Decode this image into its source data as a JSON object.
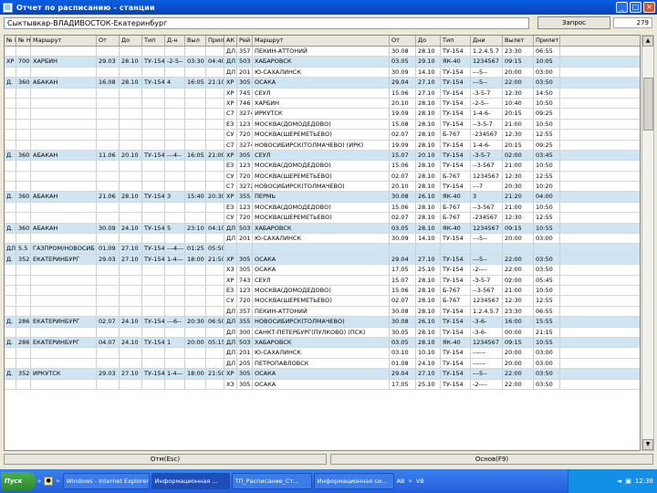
{
  "window": {
    "title": "Отчет по расписанию - станции",
    "buttons": [
      "_",
      "□",
      "×"
    ]
  },
  "filter": {
    "text": "Сыктывкар-ВЛАДИВОСТОК-Екатеринбург",
    "query_button": "Запрос",
    "count": "279"
  },
  "columns": [
    "№ Но",
    "№ Но",
    "Маршрут",
    "От",
    "До",
    "Тип",
    "Д-н",
    "Выл",
    "Прил",
    "АК",
    "Рей",
    "Маршрут",
    "От",
    "До",
    "Тип",
    "Дни",
    "Вылет",
    "Прилет"
  ],
  "rows": [
    {
      "band": false,
      "c": [
        "",
        "",
        "",
        "",
        "",
        "",
        "",
        "",
        "",
        "ДЛ",
        "357",
        "ПЕКИН-АТТОНИЙ",
        "30.08",
        "28.10",
        "ТУ-154",
        "1.2.4.5.7",
        "23:30",
        "06:55"
      ]
    },
    {
      "band": true,
      "c": [
        "ХР",
        "700",
        "ХАРБИН",
        "29.03",
        "28.10",
        "ТУ-154",
        "-2-5--",
        "03:30",
        "04:40",
        "ДЛ",
        "503",
        "ХАБАРОВСК",
        "03.05",
        "29.10",
        "ЯК-40",
        "1234567",
        "09:15",
        "10:05"
      ]
    },
    {
      "band": false,
      "c": [
        "",
        "",
        "",
        "",
        "",
        "",
        "",
        "",
        "",
        "ДЛ",
        "201",
        "Ю-САХАЛИНСК",
        "30.09",
        "14.10",
        "ТУ-154",
        "---5--",
        "20:00",
        "03:00"
      ]
    },
    {
      "band": true,
      "c": [
        "Д.",
        "360",
        "АБАКАН",
        "16.08",
        "28.10",
        "ТУ-154",
        "4",
        "16:05",
        "21:10",
        "ХР",
        "305",
        "ОСАКА",
        "29.04",
        "27.10",
        "ТУ-154",
        "---5--",
        "22:00",
        "03:50"
      ]
    },
    {
      "band": false,
      "c": [
        "",
        "",
        "",
        "",
        "",
        "",
        "",
        "",
        "",
        "ХР",
        "745",
        "СЕУЛ",
        "15.06",
        "27.10",
        "ТУ-154",
        "-3-5-7",
        "12:30",
        "14:50"
      ]
    },
    {
      "band": false,
      "c": [
        "",
        "",
        "",
        "",
        "",
        "",
        "",
        "",
        "",
        "ХР",
        "746",
        "ХАРБИН",
        "20.10",
        "28.10",
        "ТУ-154",
        "-2-5--",
        "10:40",
        "10:50"
      ]
    },
    {
      "band": false,
      "c": [
        "",
        "",
        "",
        "",
        "",
        "",
        "",
        "",
        "",
        "С7",
        "3274",
        "ИРКУТСК",
        "19.09",
        "28.10",
        "ТУ-154",
        "1-4-6-",
        "20:15",
        "09:25"
      ]
    },
    {
      "band": false,
      "c": [
        "",
        "",
        "",
        "",
        "",
        "",
        "",
        "",
        "",
        "ЕЗ",
        "123",
        "МОСКВА(ДОМОДЕДОВО)",
        "15.08",
        "28.10",
        "ТУ-154",
        "--3-5-7",
        "21:00",
        "10:50"
      ]
    },
    {
      "band": false,
      "c": [
        "",
        "",
        "",
        "",
        "",
        "",
        "",
        "",
        "",
        "СУ",
        "720",
        "МОСКВА(ШЕРЕМЕТЬЕВО)",
        "02.07",
        "28.10",
        "Б-767",
        "-234567",
        "12:30",
        "12:55"
      ]
    },
    {
      "band": false,
      "c": [
        "",
        "",
        "",
        "",
        "",
        "",
        "",
        "",
        "",
        "С7",
        "3274",
        "НОВОСИБИРСК(ТОЛМАЧЕВО) (ИРК)",
        "19.09",
        "28.10",
        "ТУ-154",
        "1-4-6-",
        "20:15",
        "09:25"
      ]
    },
    {
      "band": true,
      "c": [
        "Д.",
        "360",
        "АБАКАН",
        "11.06",
        "20.10",
        "ТУ-154",
        "---4--",
        "16:05",
        "21:00",
        "ХР",
        "305",
        "СЕУЛ",
        "15.07",
        "20.10",
        "ТУ-154",
        "-3-5-7",
        "02:00",
        "03:45"
      ]
    },
    {
      "band": false,
      "c": [
        "",
        "",
        "",
        "",
        "",
        "",
        "",
        "",
        "",
        "ЕЗ",
        "123",
        "МОСКВА(ДОМОДЕДОВО)",
        "15.06",
        "28.10",
        "ТУ-154",
        "--3-567",
        "21:00",
        "10:50"
      ]
    },
    {
      "band": false,
      "c": [
        "",
        "",
        "",
        "",
        "",
        "",
        "",
        "",
        "",
        "СУ",
        "720",
        "МОСКВА(ШЕРЕМЕТЬЕВО)",
        "02.07",
        "28.10",
        "Б-767",
        "1234567",
        "12:30",
        "12:55"
      ]
    },
    {
      "band": false,
      "c": [
        "",
        "",
        "",
        "",
        "",
        "",
        "",
        "",
        "",
        "С7",
        "3272",
        "НОВОСИБИРСК(ТОЛМАЧЕВО)",
        "20.10",
        "28.10",
        "ТУ-154",
        "---7",
        "20:30",
        "10:20"
      ]
    },
    {
      "band": true,
      "c": [
        "Д.",
        "360",
        "АБАКАН",
        "21.06",
        "28.10",
        "ТУ-154",
        "3",
        "15:40",
        "20:30",
        "ХР",
        "355",
        "ПЕРМЬ",
        "30.08",
        "26.10",
        "ЯК-40",
        "3",
        "21:20",
        "04:00"
      ]
    },
    {
      "band": false,
      "c": [
        "",
        "",
        "",
        "",
        "",
        "",
        "",
        "",
        "",
        "ЕЗ",
        "123",
        "МОСКВА(ДОМОДЕДОВО)",
        "15.06",
        "28.10",
        "Б-767",
        "--3-567",
        "21:00",
        "10:50"
      ]
    },
    {
      "band": false,
      "c": [
        "",
        "",
        "",
        "",
        "",
        "",
        "",
        "",
        "",
        "СУ",
        "720",
        "МОСКВА(ШЕРЕМЕТЬЕВО)",
        "02.07",
        "28.10",
        "Б-767",
        "-234567",
        "12:30",
        "12:55"
      ]
    },
    {
      "band": true,
      "c": [
        "Д.",
        "360",
        "АБАКАН",
        "30.09",
        "24.10",
        "ТУ-154",
        "5",
        "23:10",
        "04:10",
        "ДЛ",
        "503",
        "ХАБАРОВСК",
        "03.05",
        "28.10",
        "ЯК-40",
        "1234567",
        "09:15",
        "10:55"
      ]
    },
    {
      "band": false,
      "c": [
        "",
        "",
        "",
        "",
        "",
        "",
        "",
        "",
        "",
        "ДЛ",
        "201",
        "Ю-САХАЛИНСК",
        "30.09",
        "14.10",
        "ТУ-154",
        "---5--",
        "20:00",
        "03:00"
      ]
    },
    {
      "band": true,
      "c": [
        "ДЛ",
        "5.5",
        "ГАЗПРОМ/НОВОСИБ",
        "01.09",
        "27.10",
        "ТУ-154",
        "---4---",
        "01:25",
        "05:50",
        "",
        "",
        "",
        "",
        "",
        "",
        "",
        "",
        ""
      ]
    },
    {
      "band": true,
      "c": [
        "Д.",
        "352",
        "ЕКАТЕРИНБУРГ",
        "29.03",
        "27.10",
        "ТУ-154",
        "1-4---",
        "18:00",
        "21:50",
        "ХР",
        "305",
        "ОСАКА",
        "29.04",
        "27.10",
        "ТУ-154",
        "---5--",
        "22:00",
        "03:50"
      ]
    },
    {
      "band": false,
      "c": [
        "",
        "",
        "",
        "",
        "",
        "",
        "",
        "",
        "",
        "ХЗ",
        "305",
        "ОСАКА",
        "17.05",
        "25.10",
        "ТУ-154",
        "-2----",
        "22:00",
        "03:50"
      ]
    },
    {
      "band": false,
      "c": [
        "",
        "",
        "",
        "",
        "",
        "",
        "",
        "",
        "",
        "ХР",
        "743",
        "СЕУЛ",
        "15.07",
        "28.10",
        "ТУ-154",
        "-3-5-7",
        "02:00",
        "05:45"
      ]
    },
    {
      "band": false,
      "c": [
        "",
        "",
        "",
        "",
        "",
        "",
        "",
        "",
        "",
        "ЕЗ",
        "123",
        "МОСКВА(ДОМОДЕДОВО)",
        "15.06",
        "28.10",
        "Б-767",
        "--3-567",
        "21:00",
        "10:50"
      ]
    },
    {
      "band": false,
      "c": [
        "",
        "",
        "",
        "",
        "",
        "",
        "",
        "",
        "",
        "СУ",
        "720",
        "МОСКВА(ШЕРЕМЕТЬЕВО)",
        "02.07",
        "28.10",
        "Б-767",
        "1234567",
        "12:30",
        "12:55"
      ]
    },
    {
      "band": false,
      "c": [
        "",
        "",
        "",
        "",
        "",
        "",
        "",
        "",
        "",
        "ДЛ",
        "357",
        "ПЕКИН-АТТОНИЙ",
        "30.08",
        "28.10",
        "ТУ-154",
        "1.2.4.5.7",
        "23:30",
        "06:55"
      ]
    },
    {
      "band": true,
      "c": [
        "Д.",
        "286",
        "ЕКАТЕРИНБУРГ",
        "02.07",
        "24.10",
        "ТУ-154",
        "---6--",
        "20:30",
        "06:50",
        "ДЛ",
        "355",
        "НОВОСИБИРСК(ТОЛМАЧЕВО)",
        "30.08",
        "26.10",
        "ТУ-154",
        "-3-6-",
        "16:00",
        "15:55"
      ]
    },
    {
      "band": false,
      "c": [
        "",
        "",
        "",
        "",
        "",
        "",
        "",
        "",
        "",
        "ДЛ",
        "300",
        "САНКТ-ПЕТЕРБУРГ(ПУЛКОВО) (ПСК)",
        "30.05",
        "28.10",
        "ТУ-154",
        "-3-6-",
        "00:00",
        "21:15"
      ]
    },
    {
      "band": true,
      "c": [
        "Д.",
        "286",
        "ЕКАТЕРИНБУРГ",
        "04.07",
        "24.10",
        "ТУ-154",
        "1",
        "20:00",
        "05:15",
        "ДЛ",
        "503",
        "ХАБАРОВСК",
        "03.05",
        "28.10",
        "ЯК-40",
        "1234567",
        "09:15",
        "10:55"
      ]
    },
    {
      "band": false,
      "c": [
        "",
        "",
        "",
        "",
        "",
        "",
        "",
        "",
        "",
        "ДЛ",
        "201",
        "Ю-САХАЛИНСК",
        "03.10",
        "10.10",
        "ТУ-154",
        "------",
        "20:00",
        "03:00"
      ]
    },
    {
      "band": false,
      "c": [
        "",
        "",
        "",
        "",
        "",
        "",
        "",
        "",
        "",
        "ДЛ",
        "205",
        "ПЕТРОПАВЛОВСК",
        "01.08",
        "24.10",
        "ТУ-154",
        "------",
        "20:00",
        "03:00"
      ]
    },
    {
      "band": true,
      "c": [
        "Д.",
        "352",
        "ИРКУТСК",
        "29.03",
        "27.10",
        "ТУ-154",
        "1-4---",
        "18:00",
        "21:50",
        "ХР",
        "305",
        "ОСАКА",
        "29.04",
        "27.10",
        "ТУ-154",
        "---5--",
        "22:00",
        "03:50"
      ]
    },
    {
      "band": false,
      "c": [
        "",
        "",
        "",
        "",
        "",
        "",
        "",
        "",
        "",
        "ХЗ",
        "305",
        "ОСАКА",
        "17.05",
        "25.10",
        "ТУ-154",
        "-2----",
        "22:00",
        "03:50"
      ]
    }
  ],
  "bottom": {
    "cancel_label": "Отм(Esc)",
    "main_label": "Основ(F9)"
  },
  "taskbar": {
    "start_label": "Пуск",
    "buttons": [
      "Windows - Internet Explorer",
      "Информационная ...",
      "ТП_Расписание_Ст...",
      "Информационная си..."
    ],
    "lang_1": "AB",
    "lang_2": "VB",
    "clock": "12:38"
  }
}
